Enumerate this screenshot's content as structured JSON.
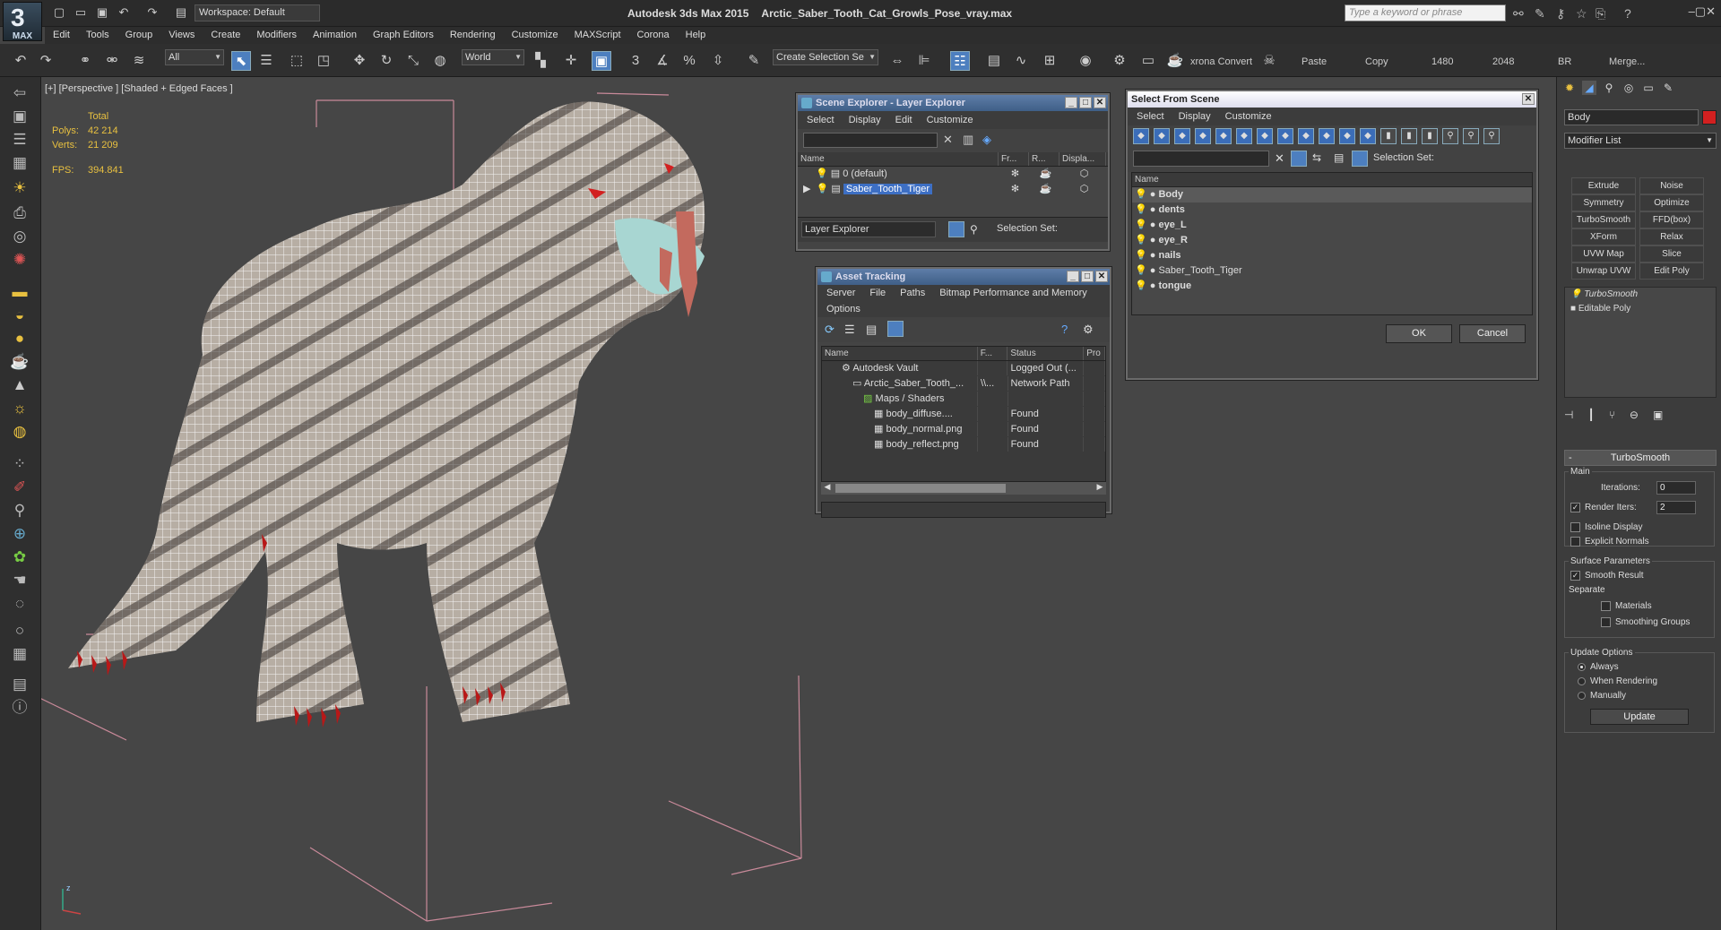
{
  "app": {
    "logo_text": "MAX",
    "workspace": "Workspace: Default",
    "title_app": "Autodesk 3ds Max  2015",
    "title_file": "Arctic_Saber_Tooth_Cat_Growls_Pose_vray.max",
    "search_placeholder": "Type a keyword or phrase"
  },
  "menu": [
    "Edit",
    "Tools",
    "Group",
    "Views",
    "Create",
    "Modifiers",
    "Animation",
    "Graph Editors",
    "Rendering",
    "Customize",
    "MAXScript",
    "Corona",
    "Help"
  ],
  "toolbar": {
    "filter": "All",
    "ref_coord": "World",
    "selection_set": "Create Selection Se",
    "corona_convert": "xrona Convert",
    "paste": "Paste",
    "copy": "Copy",
    "res1": "1480",
    "res2": "2048",
    "br": "BR",
    "merge": "Merge..."
  },
  "viewport": {
    "label": "[+] [Perspective ] [Shaded + Edged Faces ]",
    "stats_total": "Total",
    "polys_label": "Polys:",
    "polys": "42 214",
    "verts_label": "Verts:",
    "verts": "21 209",
    "fps_label": "FPS:",
    "fps": "394.841",
    "axis_z": "z",
    "axis_x": "x"
  },
  "scene_explorer": {
    "title": "Scene Explorer - Layer Explorer",
    "menu": [
      "Select",
      "Display",
      "Edit",
      "Customize"
    ],
    "columns": [
      "Name",
      "Fr...",
      "R...",
      "Displa..."
    ],
    "rows": [
      {
        "name": "0 (default)",
        "selected": false
      },
      {
        "name": "Saber_Tooth_Tiger",
        "selected": true
      }
    ],
    "footer_label": "Layer Explorer",
    "footer_sel": "Selection Set:"
  },
  "asset_tracking": {
    "title": "Asset Tracking",
    "menu": [
      "Server",
      "File",
      "Paths",
      "Bitmap Performance and Memory"
    ],
    "menu2": "Options",
    "columns": [
      "Name",
      "F...",
      "Status",
      "Pro"
    ],
    "rows": [
      {
        "name": "Autodesk Vault",
        "f": "",
        "status": "Logged Out (..."
      },
      {
        "name": "Arctic_Saber_Tooth_...",
        "f": "\\\\...",
        "status": "Network Path"
      },
      {
        "name": "Maps / Shaders",
        "f": "",
        "status": ""
      },
      {
        "name": "body_diffuse....",
        "f": "",
        "status": "Found"
      },
      {
        "name": "body_normal.png",
        "f": "",
        "status": "Found"
      },
      {
        "name": "body_reflect.png",
        "f": "",
        "status": "Found"
      }
    ]
  },
  "select_from_scene": {
    "title": "Select From Scene",
    "menu": [
      "Select",
      "Display",
      "Customize"
    ],
    "selection_set": "Selection Set:",
    "column": "Name",
    "items": [
      "Body",
      "dents",
      "eye_L",
      "eye_R",
      "nails",
      "Saber_Tooth_Tiger",
      "tongue"
    ],
    "ok": "OK",
    "cancel": "Cancel"
  },
  "command_panel": {
    "object_name": "Body",
    "object_color": "#d22020",
    "modifier_list": "Modifier List",
    "mod_buttons": [
      "Extrude",
      "Noise",
      "Symmetry",
      "Optimize",
      "TurboSmooth",
      "FFD(box)",
      "XForm",
      "Relax",
      "UVW Map",
      "Slice",
      "Unwrap UVW",
      "Edit Poly"
    ],
    "stack": [
      "TurboSmooth",
      "Editable Poly"
    ],
    "rollout": "TurboSmooth",
    "main": "Main",
    "iterations_label": "Iterations:",
    "iterations": "0",
    "render_iters_label": "Render Iters:",
    "render_iters": "2",
    "isoline": "Isoline Display",
    "explicit": "Explicit Normals",
    "surface_params": "Surface Parameters",
    "smooth_result": "Smooth Result",
    "separate": "Separate",
    "materials": "Materials",
    "smoothing_groups": "Smoothing Groups",
    "update_options": "Update Options",
    "always": "Always",
    "when_rendering": "When Rendering",
    "manually": "Manually",
    "update": "Update"
  }
}
